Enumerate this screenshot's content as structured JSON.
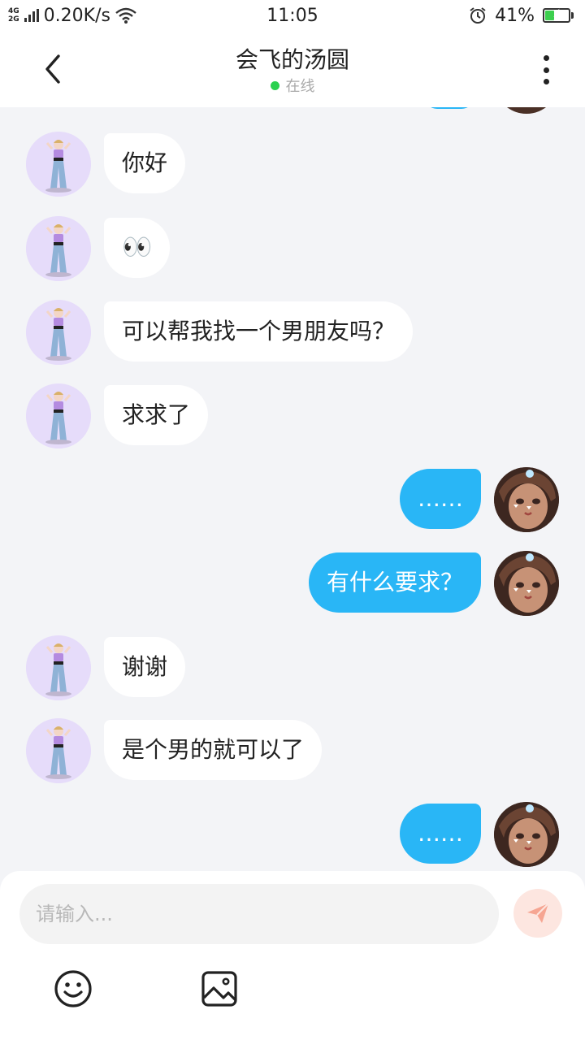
{
  "status_bar": {
    "network_top": "4G",
    "network_bottom": "2G",
    "speed": "0.20K/s",
    "time": "11:05",
    "battery": "41%",
    "battery_level": 0.41,
    "icons": [
      "signal-icon",
      "wifi-icon",
      "alarm-icon",
      "battery-icon"
    ]
  },
  "header": {
    "title": "会飞的汤圆",
    "status": "在线",
    "status_color": "#2bd14f",
    "icons": [
      "back-arrow-icon",
      "more-vertical-icon"
    ]
  },
  "messages": [
    {
      "side": "left",
      "text": "你好"
    },
    {
      "side": "left",
      "text": "👀"
    },
    {
      "side": "left",
      "text": "可以帮我找一个男朋友吗？"
    },
    {
      "side": "left",
      "text": "求求了"
    },
    {
      "side": "right",
      "text": "……"
    },
    {
      "side": "right",
      "text": "有什么要求？"
    },
    {
      "side": "left",
      "text": "谢谢"
    },
    {
      "side": "left",
      "text": "是个男的就可以了"
    },
    {
      "side": "right",
      "text": "……"
    }
  ],
  "input": {
    "placeholder": "请输入...",
    "value": ""
  },
  "toolbar": {
    "icons": [
      "send-icon",
      "smiley-icon",
      "image-icon"
    ]
  },
  "colors": {
    "accent": "#29b6f6",
    "background": "#f3f4f7",
    "send_button": "#fde6e0",
    "send_icon": "#f6a592"
  }
}
